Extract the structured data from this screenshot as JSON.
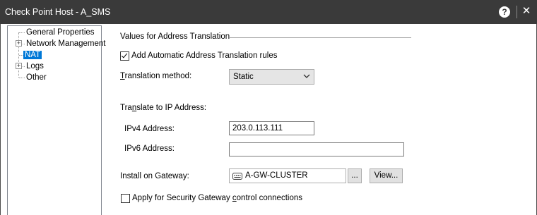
{
  "window": {
    "title": "Check Point Host - A_SMS",
    "help_label": "?",
    "close_label": "✕"
  },
  "tree": {
    "items": [
      {
        "label": "General Properties",
        "selected": false,
        "expandable": false
      },
      {
        "label": "Network Management",
        "selected": false,
        "expandable": true
      },
      {
        "label": "NAT",
        "selected": true,
        "expandable": false
      },
      {
        "label": "Logs",
        "selected": false,
        "expandable": true
      },
      {
        "label": "Other",
        "selected": false,
        "expandable": false
      }
    ],
    "expander_symbol": "+"
  },
  "nat": {
    "section_title": "Values for Address Translation",
    "auto_rules": {
      "label": "Add Automatic Address Translation rules",
      "checked": true
    },
    "method": {
      "label_accel": "T",
      "label_rest": "ranslation method:",
      "value": "Static"
    },
    "translate_to": {
      "label_pre": "Tra",
      "label_accel": "n",
      "label_rest": "slate to IP Address:"
    },
    "ipv4": {
      "label": "IPv4 Address:",
      "value": "203.0.113.111"
    },
    "ipv6": {
      "label": "IPv6 Address:",
      "value": ""
    },
    "gateway": {
      "label": "Install on Gateway:",
      "value": "A-GW-CLUSTER",
      "browse_label": "...",
      "view_label": "View..."
    },
    "apply_control": {
      "label_pre": "Apply for Security Gateway ",
      "label_accel": "c",
      "label_rest": "ontrol connections",
      "checked": false
    }
  },
  "colors": {
    "titlebar_bg": "#3a3a3a",
    "selection": "#0078d7"
  }
}
